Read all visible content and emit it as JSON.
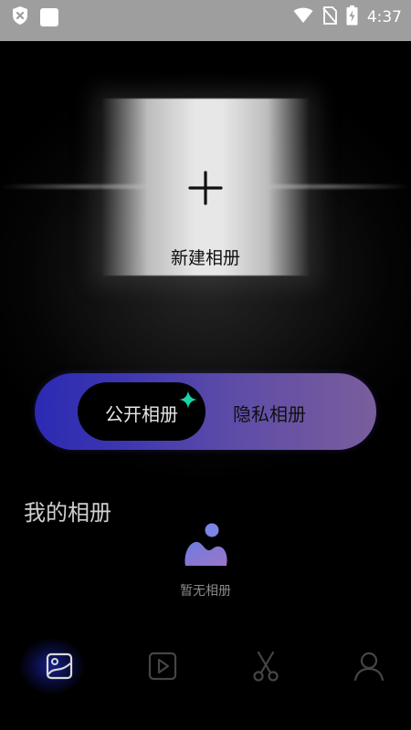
{
  "status_bar": {
    "time": "4:37",
    "icons": [
      "shield-x-icon",
      "notification-square-icon",
      "wifi-icon",
      "no-sim-icon",
      "battery-charging-icon"
    ]
  },
  "new_album": {
    "label": "新建相册",
    "icon": "plus-icon"
  },
  "album_toggle": {
    "active_label": "公开相册",
    "inactive_label": "隐私相册",
    "active_gradient_start": "#2b2ab2",
    "active_gradient_end": "#7a5e9c",
    "sparkle_color": "#1ad3a6"
  },
  "my_albums": {
    "title": "我的相册",
    "empty_text": "暂无相册",
    "empty_icon": "album-empty-icon"
  },
  "bottom_nav": {
    "items": [
      {
        "icon": "album-tab-icon",
        "active": true
      },
      {
        "icon": "video-tab-icon",
        "active": false
      },
      {
        "icon": "scissors-tab-icon",
        "active": false
      },
      {
        "icon": "profile-tab-icon",
        "active": false
      }
    ],
    "active_color": "#2a47ff"
  }
}
